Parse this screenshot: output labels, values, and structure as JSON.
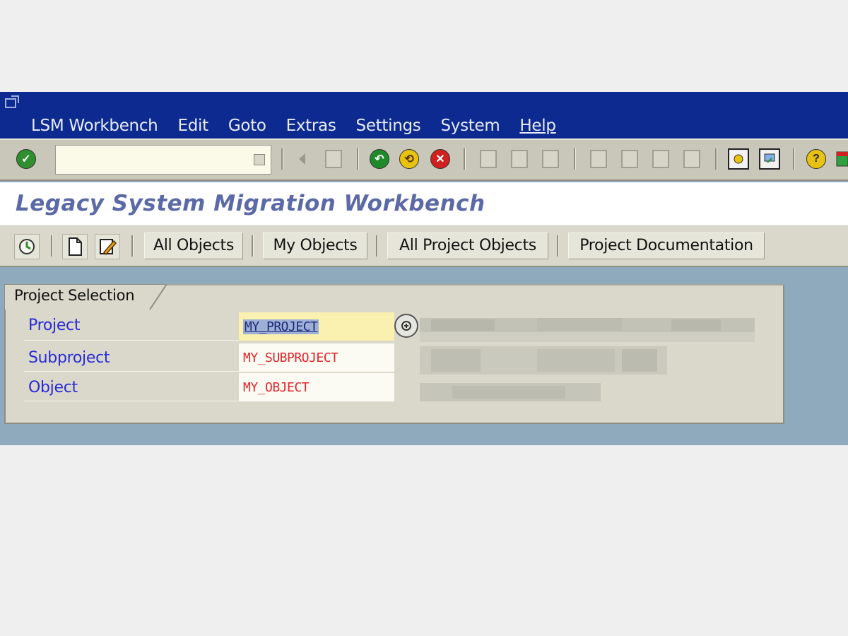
{
  "menubar": {
    "items": [
      "LSM Workbench",
      "Edit",
      "Goto",
      "Extras",
      "Settings",
      "System",
      "Help"
    ]
  },
  "toolbar": {
    "command_field_value": ""
  },
  "title": "Legacy System Migration Workbench",
  "app_toolbar": {
    "buttons": [
      "All Objects",
      "My Objects",
      "All Project Objects",
      "Project Documentation"
    ]
  },
  "project_selection": {
    "group_title": "Project Selection",
    "fields": [
      {
        "label": "Project",
        "value": "MY_PROJECT"
      },
      {
        "label": "Subproject",
        "value": "MY_SUBPROJECT"
      },
      {
        "label": "Object",
        "value": "MY_OBJECT"
      }
    ]
  },
  "colors": {
    "menubar_bg": "#0c2a8f",
    "title_text": "#5b6aa6",
    "label_text": "#2a2ad6",
    "value_text": "#e0252a",
    "background": "#8fa9bd"
  }
}
